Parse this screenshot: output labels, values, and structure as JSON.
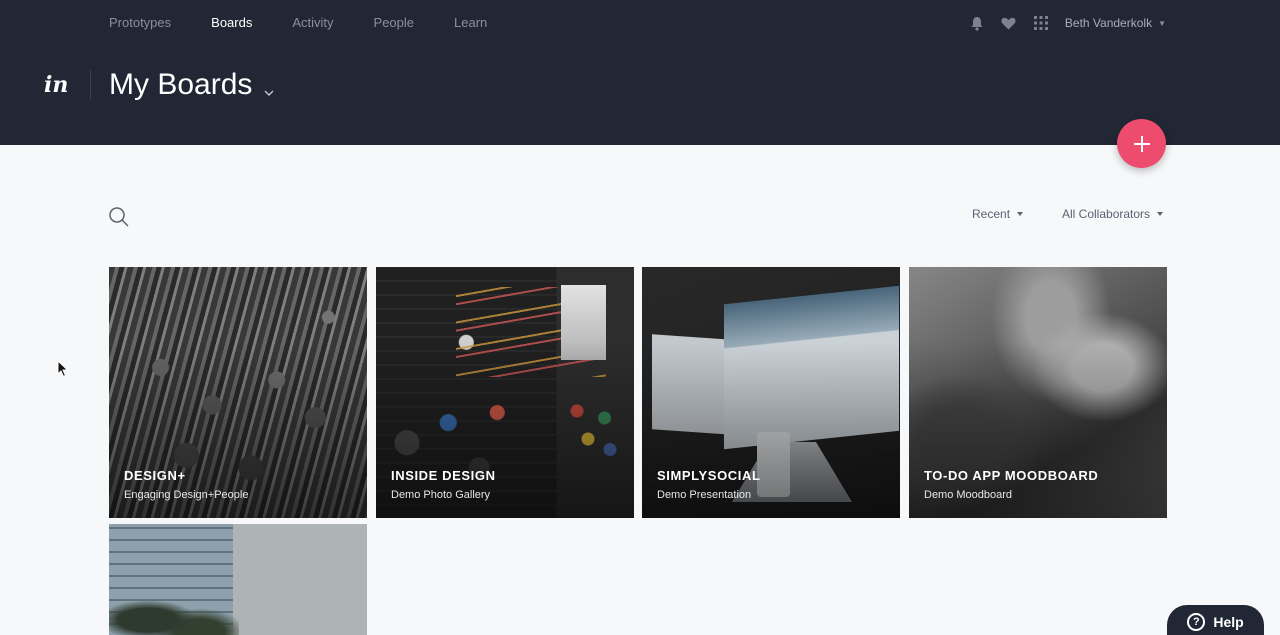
{
  "nav": {
    "items": [
      {
        "label": "Prototypes"
      },
      {
        "label": "Boards",
        "active": true
      },
      {
        "label": "Activity"
      },
      {
        "label": "People"
      },
      {
        "label": "Learn"
      }
    ],
    "icons": [
      "bell-icon",
      "heart-icon",
      "apps-grid-icon"
    ],
    "user_name": "Beth Vanderkolk"
  },
  "header": {
    "logo_text": "in",
    "title": "My Boards"
  },
  "toolbar": {
    "sort_label": "Recent",
    "collaborators_label": "All Collaborators"
  },
  "boards": [
    {
      "title": "DESIGN+",
      "subtitle": "Engaging Design+People"
    },
    {
      "title": "INSIDE DESIGN",
      "subtitle": "Demo Photo Gallery"
    },
    {
      "title": "SIMPLYSOCIAL",
      "subtitle": "Demo Presentation"
    },
    {
      "title": "TO-DO APP MOODBOARD",
      "subtitle": "Demo Moodboard"
    },
    {
      "title": "",
      "subtitle": ""
    }
  ],
  "help": {
    "label": "Help"
  },
  "colors": {
    "header_bg": "#222735",
    "accent": "#ee4c6e",
    "page_bg": "#f7f8fa"
  }
}
